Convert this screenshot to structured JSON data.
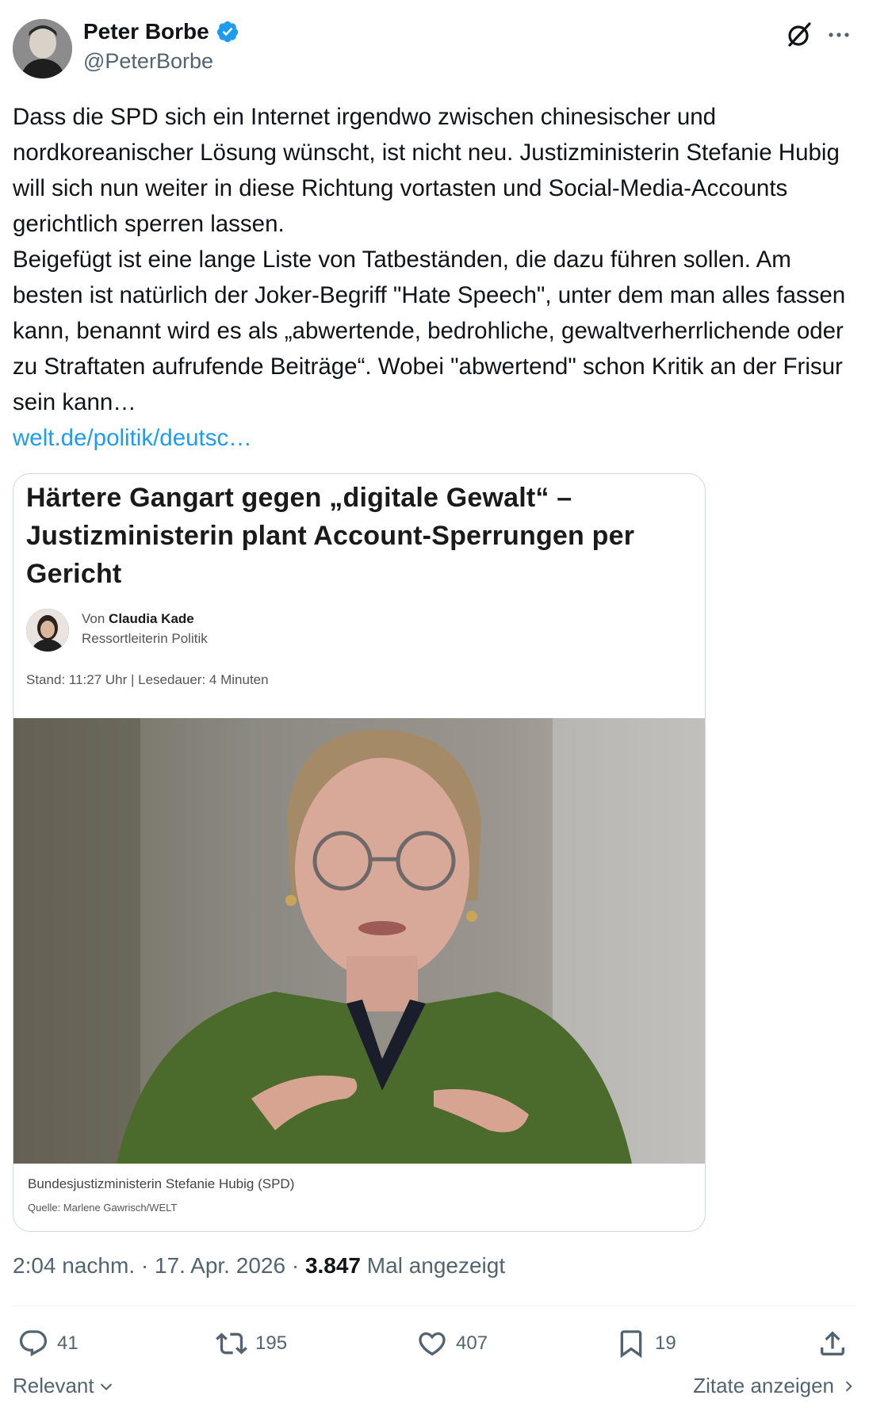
{
  "author": {
    "name": "Peter Borbe",
    "handle": "@PeterBorbe",
    "verified": true
  },
  "tweet": {
    "paragraphs": [
      "Dass die SPD sich ein Internet irgendwo zwischen chinesischer und nordkoreanischer Lösung wünscht, ist nicht neu. Justizministerin Stefanie Hubig will sich nun weiter in diese Richtung vortasten und Social-Media-Accounts gerichtlich sperren lassen.",
      "Beigefügt ist eine lange Liste von Tatbeständen, die dazu führen sollen. Am besten ist natürlich der Joker-Begriff \"Hate Speech\", unter dem man alles fassen kann, benannt wird es als „abwertende, bedrohliche, gewaltverherrlichende oder zu Straftaten aufrufende Beiträge“. Wobei \"abwertend\" schon Kritik an der Frisur sein kann…"
    ],
    "link": "welt.de/politik/deutsc…"
  },
  "card": {
    "headline": "Härtere Gangart gegen „digitale Gewalt“ – Justizministerin plant Account-Sperrungen per Gericht",
    "author_prefix": "Von",
    "author_name": "Claudia Kade",
    "author_role": "Ressortleiterin Politik",
    "meta": "Stand: 11:27 Uhr | Lesedauer: 4 Minuten",
    "caption": "Bundesjustizministerin Stefanie Hubig (SPD)",
    "credit": "Quelle: Marlene Gawrisch/WELT"
  },
  "footer": {
    "time": "2:04 nachm.",
    "date": "17. Apr. 2026",
    "views_count": "3.847",
    "views_label": "Mal angezeigt"
  },
  "actions": {
    "replies": "41",
    "reposts": "195",
    "likes": "407",
    "bookmarks": "19"
  },
  "bottom": {
    "sort_label": "Relevant",
    "quotes_label": "Zitate anzeigen"
  },
  "colors": {
    "accent": "#1d9bf0",
    "secondary_text": "#536471",
    "primary_text": "#0f1419"
  },
  "icons": [
    "verified-badge-icon",
    "grok-icon",
    "more-icon",
    "reply-icon",
    "repost-icon",
    "like-icon",
    "bookmark-icon",
    "share-icon",
    "chevron-down-icon",
    "chevron-right-icon"
  ]
}
